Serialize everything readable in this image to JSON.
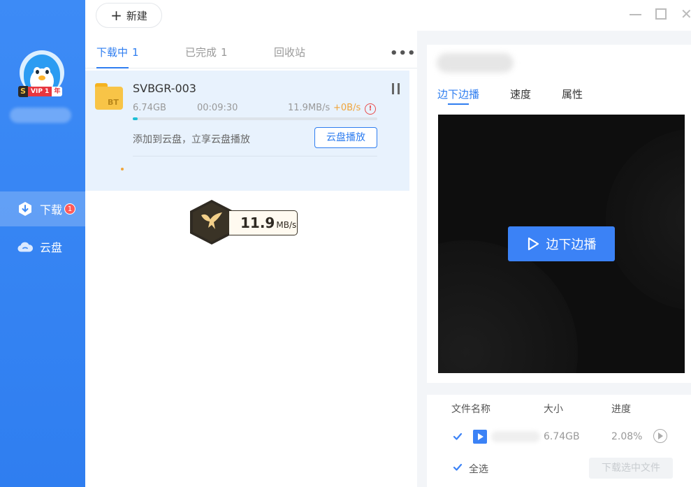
{
  "sidebar": {
    "vip": {
      "s": "S",
      "label": "VIP 1",
      "year": "年"
    },
    "items": [
      {
        "label": "下载",
        "badge": "1",
        "icon": "download-icon"
      },
      {
        "label": "云盘",
        "icon": "cloud-icon"
      }
    ]
  },
  "toolbar": {
    "new_label": "新建"
  },
  "tabs": [
    {
      "label": "下载中",
      "count": "1"
    },
    {
      "label": "已完成",
      "count": "1"
    },
    {
      "label": "回收站",
      "count": ""
    }
  ],
  "more_label": "•••",
  "task": {
    "name": "SVBGR-003",
    "icon_label": "BT",
    "size": "6.74GB",
    "time": "00:09:30",
    "speed": "11.9MB/s",
    "extra_speed": "+0B/s",
    "progress": 0.0208,
    "cloud_hint": "添加到云盘，立享云盘播放",
    "cloud_button": "云盘播放"
  },
  "speed_widget": {
    "value": "11.9",
    "unit": "MB/s"
  },
  "detail": {
    "tabs": [
      "边下边播",
      "速度",
      "属性"
    ],
    "play_button": "边下边播"
  },
  "files": {
    "headers": {
      "name": "文件名称",
      "size": "大小",
      "progress": "进度"
    },
    "rows": [
      {
        "size": "6.74GB",
        "progress": "2.08%",
        "checked": true
      }
    ],
    "select_all": "全选",
    "download_selected": "下载选中文件"
  },
  "colors": {
    "accent": "#2f7ef0",
    "sidebar": "#3d8bf6",
    "progress": "#1dbfd6"
  }
}
